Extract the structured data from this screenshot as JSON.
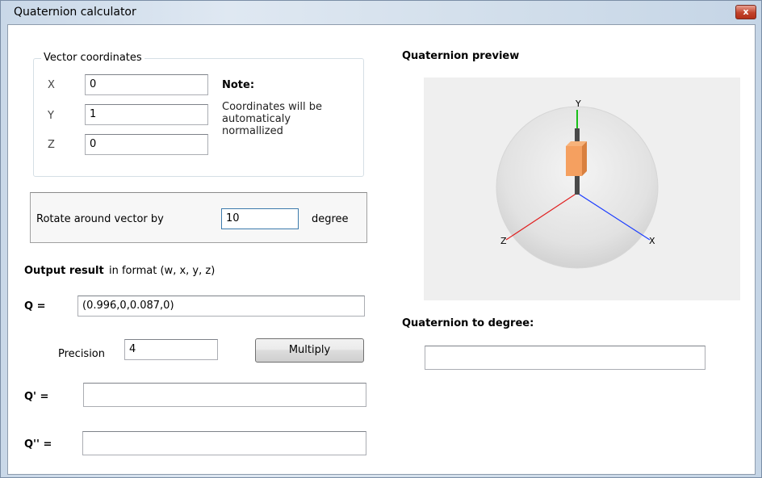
{
  "window": {
    "title": "Quaternion calculator",
    "close_glyph": "x"
  },
  "vector_group": {
    "title": "Vector coordinates",
    "x_label": "X",
    "x_value": "0",
    "y_label": "Y",
    "y_value": "1",
    "z_label": "Z",
    "z_value": "0",
    "note_title": "Note:",
    "note_text": "Coordinates will be automaticaly normallized"
  },
  "rotate": {
    "label": "Rotate around vector by",
    "value": "10",
    "unit": "degree"
  },
  "output": {
    "title": "Output result",
    "format": "in format (w, x, y, z)",
    "q_label": "Q =",
    "q_value": "(0.996,0,0.087,0)",
    "precision_label": "Precision",
    "precision_value": "4",
    "multiply_label": "Multiply",
    "q1_label": "Q' =",
    "q1_value": "",
    "q2_label": "Q'' =",
    "q2_value": ""
  },
  "preview": {
    "title": "Quaternion preview",
    "axis_x": "X",
    "axis_y": "Y",
    "axis_z": "Z",
    "colors": {
      "x_axis": "#1a3cff",
      "y_axis": "#18c018",
      "z_axis": "#e02020",
      "cube": "#f5a060"
    }
  },
  "to_degree": {
    "title": "Quaternion to degree:",
    "value": ""
  }
}
